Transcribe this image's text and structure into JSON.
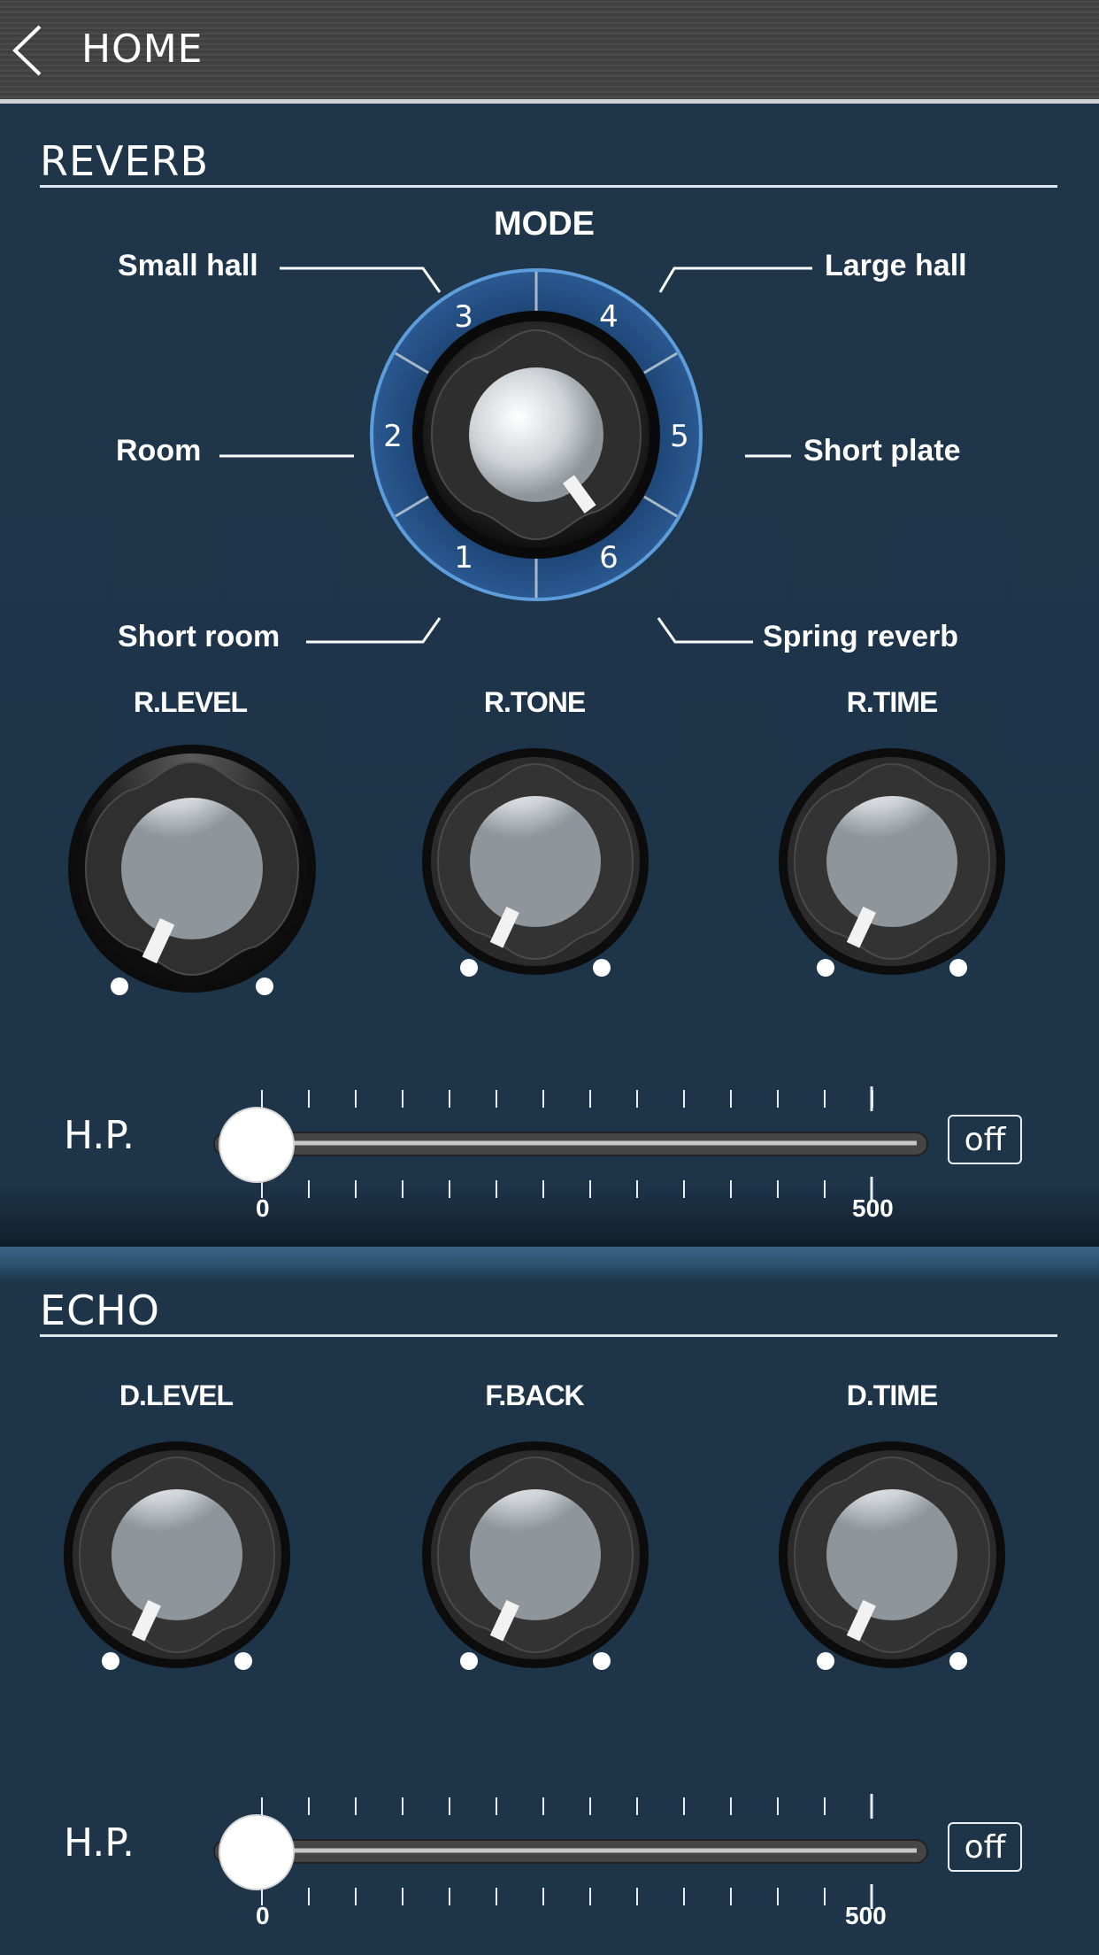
{
  "header": {
    "home_label": "HOME"
  },
  "reverb": {
    "title": "REVERB",
    "mode": {
      "label": "MODE",
      "numbers": [
        "1",
        "2",
        "3",
        "4",
        "5",
        "6"
      ],
      "selected": 6,
      "options": {
        "small_hall": "Small hall",
        "large_hall": "Large hall",
        "room": "Room",
        "short_plate": "Short plate",
        "short_room": "Short room",
        "spring_reverb": "Spring reverb"
      }
    },
    "knobs": {
      "level": "R.LEVEL",
      "tone": "R.TONE",
      "time": "R.TIME"
    },
    "hp": {
      "label": "H.P.",
      "min": "0",
      "max": "500",
      "value_fraction": 0,
      "off_label": "off"
    }
  },
  "echo": {
    "title": "ECHO",
    "knobs": {
      "level": "D.LEVEL",
      "feedback": "F.BACK",
      "time": "D.TIME"
    },
    "hp": {
      "label": "H.P.",
      "min": "0",
      "max": "500",
      "value_fraction": 0,
      "off_label": "off"
    }
  },
  "colors": {
    "panel": "#1d3449",
    "mode_ring": "#234a7a",
    "accent": "#4a8fd6"
  }
}
